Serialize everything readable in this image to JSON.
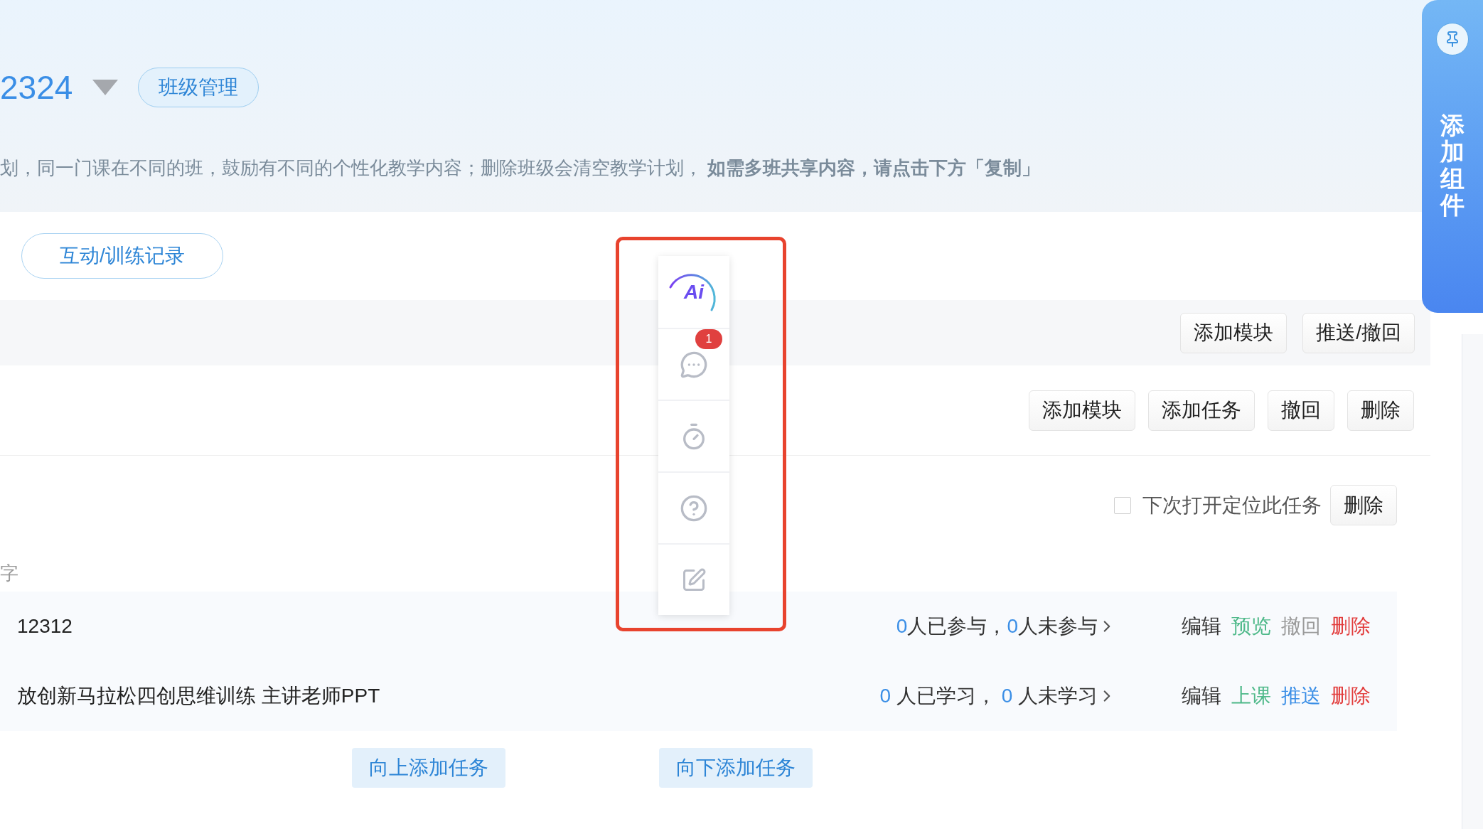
{
  "header": {
    "class_name": "2324",
    "manage_button": "班级管理",
    "notice": "划，同一门课在不同的班，鼓励有不同的个性化教学内容；删除班级会清空教学计划， **如需多班共享内容，请点击下方「复制」**"
  },
  "record_button": "互动/训练记录",
  "module_bar": {
    "buttons": [
      "添加模块",
      "推送/撤回"
    ]
  },
  "module_actions": [
    "添加模块",
    "添加任务",
    "撤回",
    "删除"
  ],
  "task_option": {
    "label": "下次打开定位此任务",
    "checked": false,
    "button": "删除"
  },
  "column_label": "字",
  "tasks": [
    {
      "title": "12312",
      "stats": [
        {
          "count": "0",
          "label": "人已参与，"
        },
        {
          "count": "0",
          "label": "人未参与"
        }
      ],
      "actions": [
        {
          "label": "编辑",
          "kind": "neutral"
        },
        {
          "label": "预览",
          "kind": "success"
        },
        {
          "label": "撤回",
          "kind": "muted"
        },
        {
          "label": "删除",
          "kind": "danger"
        }
      ]
    },
    {
      "title": "放创新马拉松四创思维训练 主讲老师PPT",
      "stats": [
        {
          "count": "0",
          "label": " 人已学习， "
        },
        {
          "count": "0",
          "label": " 人未学习"
        }
      ],
      "actions": [
        {
          "label": "编辑",
          "kind": "neutral"
        },
        {
          "label": "上课",
          "kind": "success"
        },
        {
          "label": "推送",
          "kind": "primary"
        },
        {
          "label": "删除",
          "kind": "danger"
        }
      ]
    }
  ],
  "add_buttons": [
    "向上添加任务",
    "向下添加任务"
  ],
  "floating_toolbar": {
    "items": [
      {
        "kind": "ai",
        "label": "Ai"
      },
      {
        "kind": "chat",
        "badge": "1"
      },
      {
        "kind": "timer"
      },
      {
        "kind": "help"
      },
      {
        "kind": "edit"
      }
    ]
  },
  "side_tab": {
    "label": "添加组件"
  }
}
